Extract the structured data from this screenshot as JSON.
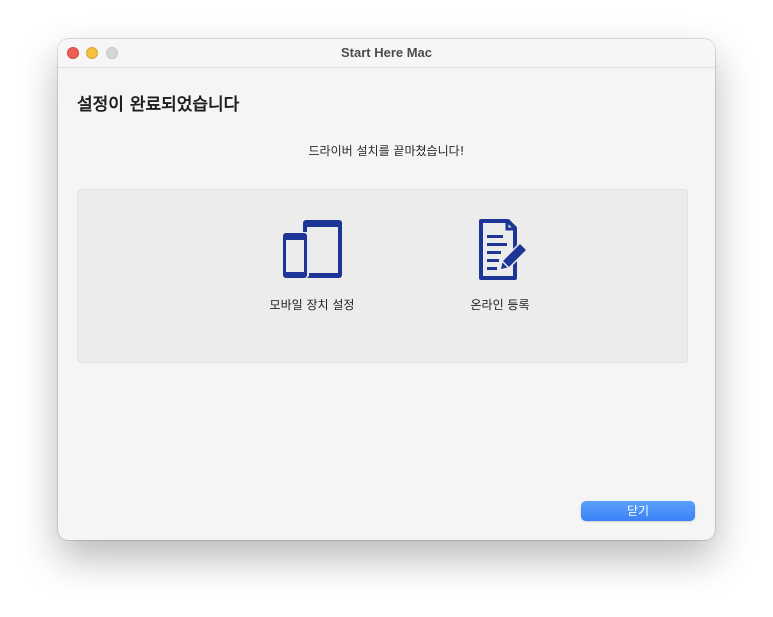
{
  "window": {
    "title": "Start Here Mac"
  },
  "main": {
    "heading": "설정이 완료되었습니다",
    "subtitle": "드라이버 설치를 끝마쳤습니다!"
  },
  "options": [
    {
      "label": "모바일 장치 설정",
      "icon": "mobile-devices-icon"
    },
    {
      "label": "온라인 등록",
      "icon": "document-edit-icon"
    }
  ],
  "footer": {
    "close_label": "닫기"
  },
  "colors": {
    "icon": "#1d3596",
    "accent": "#3b82f7",
    "window_bg": "#f5f5f5",
    "panel_bg": "#ececec"
  }
}
